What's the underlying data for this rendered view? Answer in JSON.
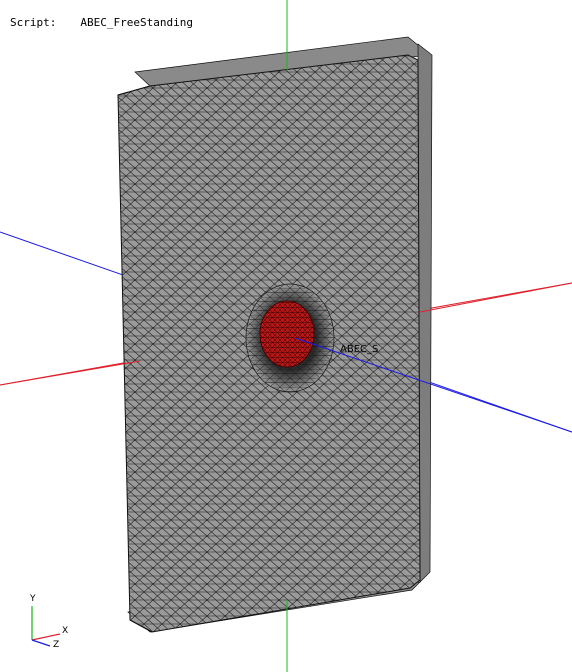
{
  "header": {
    "script_label": "Script:",
    "script_name": "ABEC_FreeStanding"
  },
  "scene": {
    "background_color": "#ffffff",
    "body_fill": "#9a9a9a",
    "mesh_color": "#111111",
    "driver_fill": "#b81818",
    "axis_x_color": "#e0202a",
    "axis_y_color": "#18b818",
    "axis_z_color": "#1a1ae6",
    "origin_label": "ABEC_S"
  },
  "triad": {
    "x_label": "X",
    "y_label": "Y",
    "z_label": "Z"
  }
}
